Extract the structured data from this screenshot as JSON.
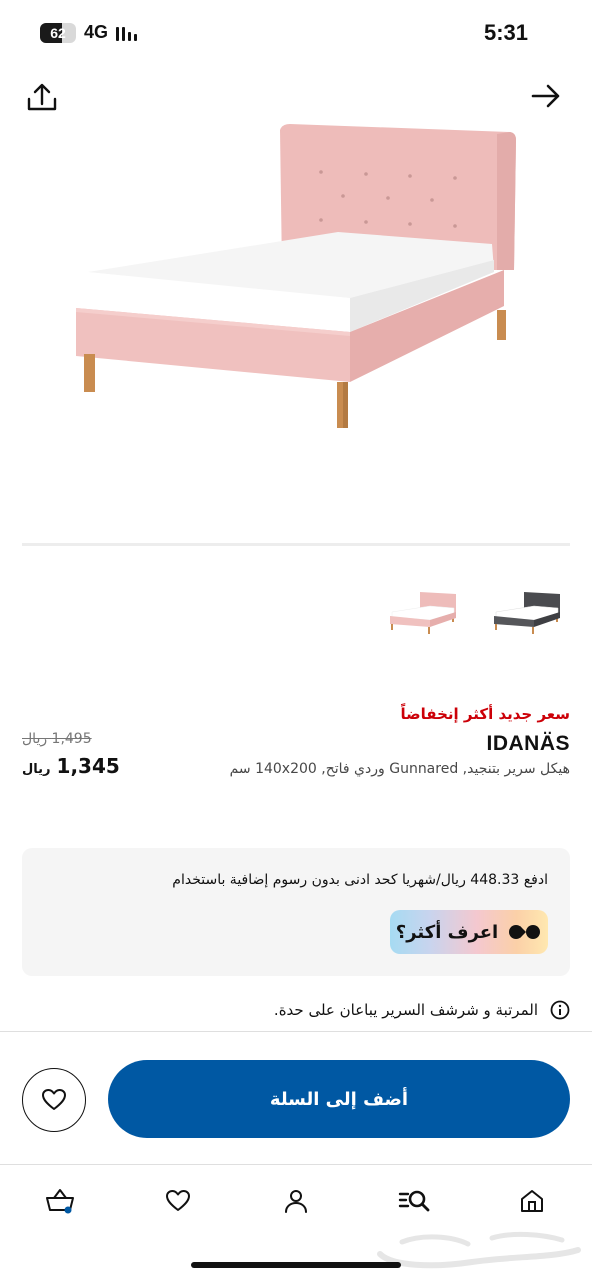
{
  "status_bar": {
    "battery_level": "62",
    "battery_fraction": 0.62,
    "network": "4G",
    "time": "5:31"
  },
  "header": {
    "share_icon": "share-icon",
    "forward_icon": "arrow-right-icon"
  },
  "product": {
    "new_price_label": "سعر جديد أكثر إنخفاضاً",
    "name": "IDANÄS",
    "description": "هيكل سرير بتنجيد, Gunnared وردي فاتح, 140x200 سم",
    "old_price": "1,495 ريال",
    "price_value": "1,345",
    "price_currency": "ريال",
    "variants": [
      "pink-bed",
      "dark-grey-bed"
    ],
    "colors": {
      "bed_pink": "#eebcba",
      "bed_dark": "#4a4b4f",
      "leg_wood": "#c98c50"
    }
  },
  "payment": {
    "text": "ادفع 448.33 ريال/شهريا كحد ادنى بدون رسوم إضافية باستخدام",
    "learn_more_label": "اعرف أكثر؟"
  },
  "info": {
    "text": "المرتبة و شرشف السرير يباعان على حدة."
  },
  "actions": {
    "add_to_cart_label": "أضف إلى السلة",
    "favorite_icon": "heart-icon",
    "accent_color": "#0058a3",
    "sale_color": "#cc0008"
  },
  "bottom_nav": {
    "items": [
      "cart-icon",
      "heart-icon",
      "profile-icon",
      "search-icon",
      "home-icon"
    ]
  }
}
